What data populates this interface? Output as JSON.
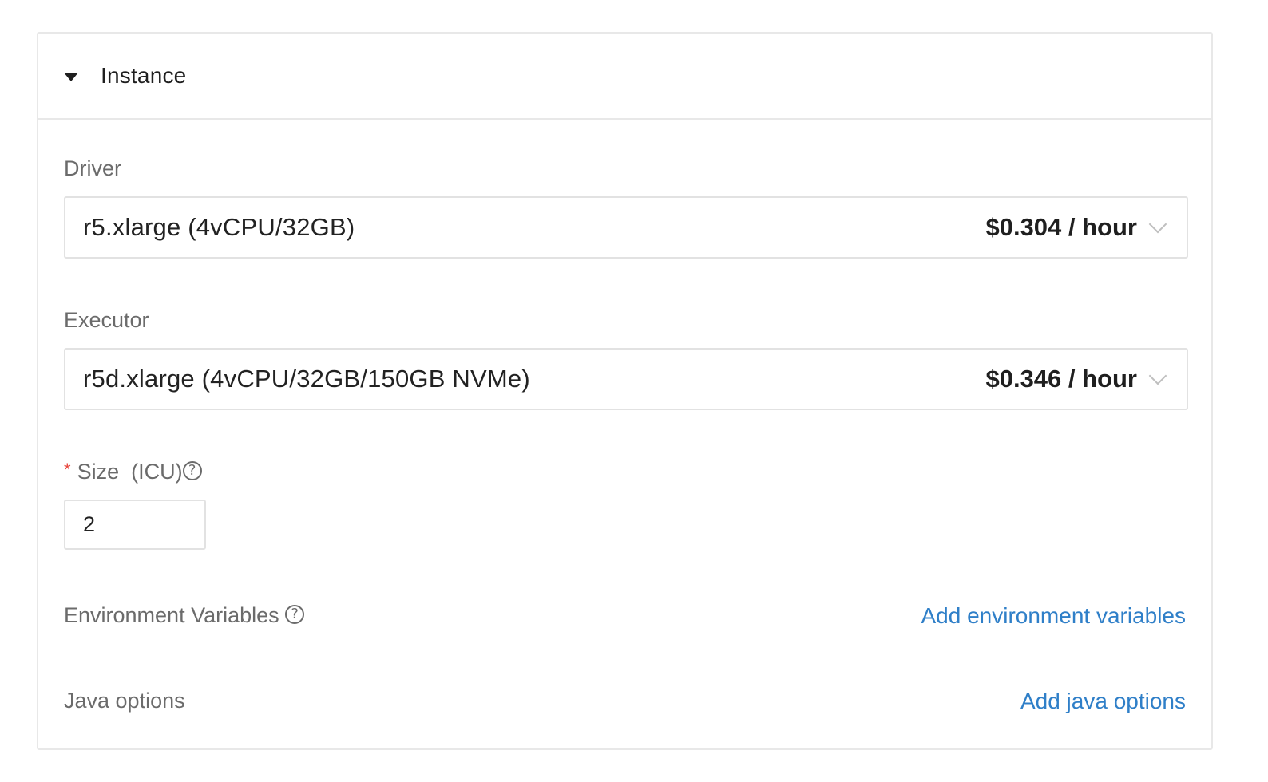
{
  "panel": {
    "title": "Instance",
    "expanded": true
  },
  "driver": {
    "label": "Driver",
    "value": "r5.xlarge (4vCPU/32GB)",
    "price": "$0.304 / hour"
  },
  "executor": {
    "label": "Executor",
    "value": "r5d.xlarge (4vCPU/32GB/150GB NVMe)",
    "price": "$0.346 / hour"
  },
  "size": {
    "required_mark": "*",
    "label": "Size",
    "unit": "(ICU)",
    "value": "2"
  },
  "env_vars": {
    "label": "Environment Variables",
    "link": "Add environment variables"
  },
  "java_options": {
    "label": "Java options",
    "link": "Add java options"
  },
  "help_glyph": "?",
  "colors": {
    "link": "#2f7fc8",
    "required": "#e8453c",
    "border": "#e8e8e8",
    "label": "#6b6b6b"
  }
}
